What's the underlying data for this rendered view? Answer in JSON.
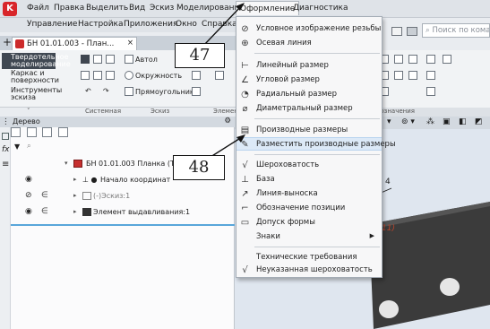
{
  "menubar": {
    "row1": [
      "Файл",
      "Правка",
      "Выделить",
      "Вид",
      "Эскиз",
      "Моделирование",
      "Оформление",
      "Диагностика"
    ],
    "row2": [
      "Управление",
      "Настройка",
      "Приложения",
      "Окно",
      "Справка"
    ],
    "active": "Оформление"
  },
  "search": {
    "placeholder": "Поиск по кома"
  },
  "doc_tab": {
    "label": "БН 01.01.003 - План..."
  },
  "ribbon": {
    "left_group": [
      "Твердотельное моделирование",
      "Каркас и поверхности",
      "Инструменты эскиза"
    ],
    "circle_btn": "Окружность",
    "rect_btn": "Прямоугольник",
    "auto_btn": "Автол",
    "sections": [
      "Системная",
      "Эскиз",
      "Элемен"
    ],
    "right_section": "бозначения"
  },
  "tree_panel": {
    "title": "Дерево",
    "items": [
      "БН 01.01.003 Планка (Тел-1)",
      "Начало координат",
      "(-)Эскиз:1",
      "Элемент выдавливания:1"
    ]
  },
  "dropdown": {
    "items": [
      {
        "icon": "thread-icon",
        "label": "Условное изображение резьбы"
      },
      {
        "icon": "axis-icon",
        "label": "Осевая линия"
      },
      {
        "icon": "linear-dim-icon",
        "label": "Линейный размер"
      },
      {
        "icon": "angular-dim-icon",
        "label": "Угловой размер"
      },
      {
        "icon": "radial-dim-icon",
        "label": "Радиальный размер"
      },
      {
        "icon": "diameter-dim-icon",
        "label": "Диаметральный размер"
      },
      {
        "icon": "derived-dims-icon",
        "label": "Производные размеры"
      },
      {
        "icon": "place-derived-dims-icon",
        "label": "Разместить производные размеры"
      },
      {
        "icon": "roughness-icon",
        "label": "Шероховатость"
      },
      {
        "icon": "base-icon",
        "label": "База"
      },
      {
        "icon": "leader-line-icon",
        "label": "Линия-выноска"
      },
      {
        "icon": "position-icon",
        "label": "Обозначение позиции"
      },
      {
        "icon": "form-tolerance-icon",
        "label": "Допуск формы"
      },
      {
        "icon": "",
        "label": "Знаки"
      },
      {
        "icon": "",
        "label": "Технические требования"
      },
      {
        "icon": "unspecified-roughness-icon",
        "label": "Неуказанная шероховатость"
      }
    ],
    "highlighted": "Разместить производные размеры"
  },
  "callouts": [
    "47",
    "48"
  ],
  "canvas": {
    "red_annotation": "11)",
    "dim_digit": "4"
  }
}
